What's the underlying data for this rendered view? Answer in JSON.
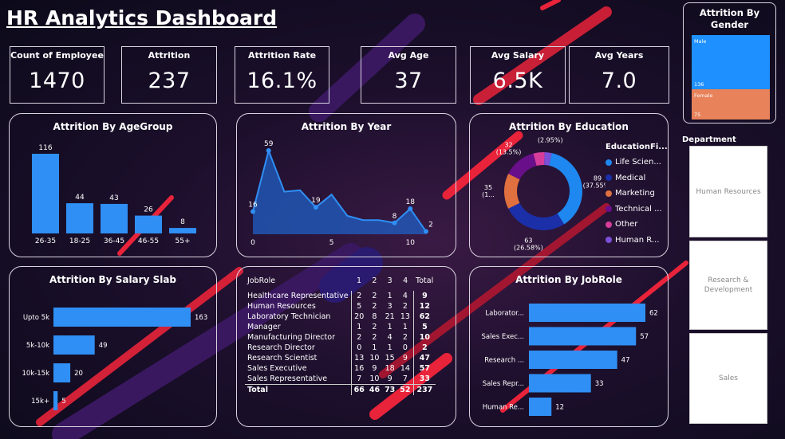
{
  "title": "HR Analytics Dashboard",
  "kpis": [
    {
      "label": "Count of Employee",
      "value": "1470"
    },
    {
      "label": "Attrition",
      "value": "237"
    },
    {
      "label": "Attrition Rate",
      "value": "16.1%"
    },
    {
      "label": "Avg Age",
      "value": "37"
    },
    {
      "label": "Avg Salary",
      "value": "6.5K"
    },
    {
      "label": "Avg Years",
      "value": "7.0"
    }
  ],
  "gender": {
    "title": "Attrition By Gender",
    "items": [
      {
        "label": "Male",
        "value": 136,
        "color": "#1e90ff"
      },
      {
        "label": "Female",
        "value": 75,
        "color": "#e8825a"
      }
    ]
  },
  "department": {
    "title": "Department",
    "items": [
      "Human Resources",
      "Research & Development",
      "Sales"
    ]
  },
  "colors": {
    "bar": "#2f8ff5",
    "line": "#1f6fd8",
    "accent_stripe": "#e8233a"
  },
  "chart_data": [
    {
      "type": "bar",
      "title": "Attrition By AgeGroup",
      "categories": [
        "26-35",
        "18-25",
        "36-45",
        "46-55",
        "55+"
      ],
      "values": [
        116,
        44,
        43,
        26,
        8
      ]
    },
    {
      "type": "area",
      "title": "Attrition By Year",
      "x": [
        0,
        1,
        2,
        3,
        4,
        5,
        6,
        7,
        8,
        9,
        10,
        11
      ],
      "values": [
        16,
        59,
        30,
        31,
        19,
        28,
        13,
        10,
        10,
        8,
        18,
        2
      ],
      "labeled_points": [
        {
          "x": 0,
          "label": "16"
        },
        {
          "x": 1,
          "label": "59"
        },
        {
          "x": 4,
          "label": "19"
        },
        {
          "x": 9,
          "label": "8"
        },
        {
          "x": 10,
          "label": "18"
        },
        {
          "x": 11,
          "label": "2"
        }
      ],
      "x_ticks": [
        "0",
        "5",
        "10"
      ]
    },
    {
      "type": "pie",
      "title": "Attrition By Education",
      "legend_title": "EducationFi...",
      "legend_position": "right",
      "slices": [
        {
          "name": "Life Scien...",
          "value": 89,
          "label": "89\n(37.55%)",
          "color": "#1e88f0"
        },
        {
          "name": "Medical",
          "value": 63,
          "label": "63\n(26.58%)",
          "color": "#1a2fa8"
        },
        {
          "name": "Marketing",
          "value": 35,
          "label": "35\n(1...",
          "color": "#e07040"
        },
        {
          "name": "Technical ...",
          "value": 32,
          "label": "32\n(13.5%)",
          "color": "#6a0f8a"
        },
        {
          "name": "Other",
          "value": 11,
          "label": "",
          "color": "#d63d9a"
        },
        {
          "name": "Human R...",
          "value": 7,
          "label": "7\n(2.95%)",
          "color": "#7b4fd6"
        }
      ]
    },
    {
      "type": "bar",
      "orientation": "horizontal",
      "title": "Attrition By Salary Slab",
      "categories": [
        "Upto 5k",
        "5k-10k",
        "10k-15k",
        "15k+"
      ],
      "values": [
        163,
        49,
        20,
        5
      ]
    },
    {
      "type": "table",
      "columns": [
        "JobRole",
        "1",
        "2",
        "3",
        "4",
        "Total"
      ],
      "rows": [
        [
          "Healthcare Representative",
          "2",
          "2",
          "1",
          "4",
          "9"
        ],
        [
          "Human Resources",
          "5",
          "2",
          "3",
          "2",
          "12"
        ],
        [
          "Laboratory Technician",
          "20",
          "8",
          "21",
          "13",
          "62"
        ],
        [
          "Manager",
          "1",
          "2",
          "1",
          "1",
          "5"
        ],
        [
          "Manufacturing Director",
          "2",
          "2",
          "4",
          "2",
          "10"
        ],
        [
          "Research Director",
          "0",
          "1",
          "1",
          "0",
          "2"
        ],
        [
          "Research Scientist",
          "13",
          "10",
          "15",
          "9",
          "47"
        ],
        [
          "Sales Executive",
          "16",
          "9",
          "18",
          "14",
          "57"
        ],
        [
          "Sales Representative",
          "7",
          "10",
          "9",
          "7",
          "33"
        ]
      ],
      "total_row": [
        "Total",
        "66",
        "46",
        "73",
        "52",
        "237"
      ]
    },
    {
      "type": "bar",
      "orientation": "horizontal",
      "title": "Attrition By JobRole",
      "categories": [
        "Laborator...",
        "Sales Exec...",
        "Research ...",
        "Sales Repr...",
        "Human Re..."
      ],
      "values": [
        62,
        57,
        47,
        33,
        12
      ]
    }
  ]
}
